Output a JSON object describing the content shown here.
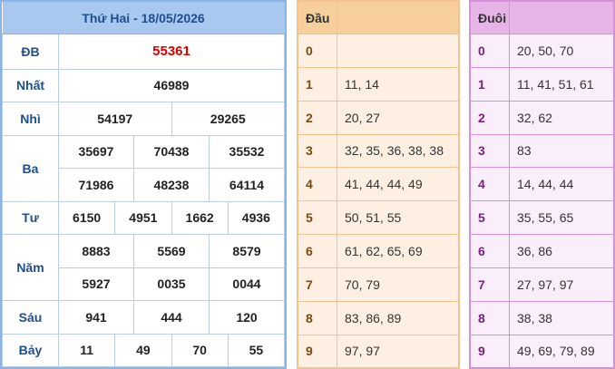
{
  "results": {
    "date_title": "Thứ Hai - 18/05/2026",
    "rows": [
      {
        "label": "ĐB",
        "values": [
          "55361"
        ]
      },
      {
        "label": "Nhất",
        "values": [
          "46989"
        ]
      },
      {
        "label": "Nhì",
        "values": [
          "54197",
          "29265"
        ]
      },
      {
        "label": "Ba",
        "values": [
          "35697",
          "70438",
          "35532",
          "71986",
          "48238",
          "64114"
        ]
      },
      {
        "label": "Tư",
        "values": [
          "6150",
          "4951",
          "1662",
          "4936"
        ]
      },
      {
        "label": "Năm",
        "values": [
          "8883",
          "5569",
          "8579",
          "5927",
          "0035",
          "0044"
        ]
      },
      {
        "label": "Sáu",
        "values": [
          "941",
          "444",
          "120"
        ]
      },
      {
        "label": "Bảy",
        "values": [
          "11",
          "49",
          "70",
          "55"
        ]
      }
    ]
  },
  "dau": {
    "header": "Đầu",
    "rows": [
      {
        "digit": "0",
        "values": ""
      },
      {
        "digit": "1",
        "values": "11, 14"
      },
      {
        "digit": "2",
        "values": "20, 27"
      },
      {
        "digit": "3",
        "values": "32, 35, 36, 38, 38"
      },
      {
        "digit": "4",
        "values": "41, 44, 44, 49"
      },
      {
        "digit": "5",
        "values": "50, 51, 55"
      },
      {
        "digit": "6",
        "values": "61, 62, 65, 69"
      },
      {
        "digit": "7",
        "values": "70, 79"
      },
      {
        "digit": "8",
        "values": "83, 86, 89"
      },
      {
        "digit": "9",
        "values": "97, 97"
      }
    ]
  },
  "duoi": {
    "header": "Đuôi",
    "rows": [
      {
        "digit": "0",
        "values": "20, 50, 70"
      },
      {
        "digit": "1",
        "values": "11, 41, 51, 61"
      },
      {
        "digit": "2",
        "values": "32, 62"
      },
      {
        "digit": "3",
        "values": "83"
      },
      {
        "digit": "4",
        "values": "14, 44, 44"
      },
      {
        "digit": "5",
        "values": "35, 55, 65"
      },
      {
        "digit": "6",
        "values": "36, 86"
      },
      {
        "digit": "7",
        "values": "27, 97, 97"
      },
      {
        "digit": "8",
        "values": "38, 38"
      },
      {
        "digit": "9",
        "values": "49, 69, 79, 89"
      }
    ]
  }
}
